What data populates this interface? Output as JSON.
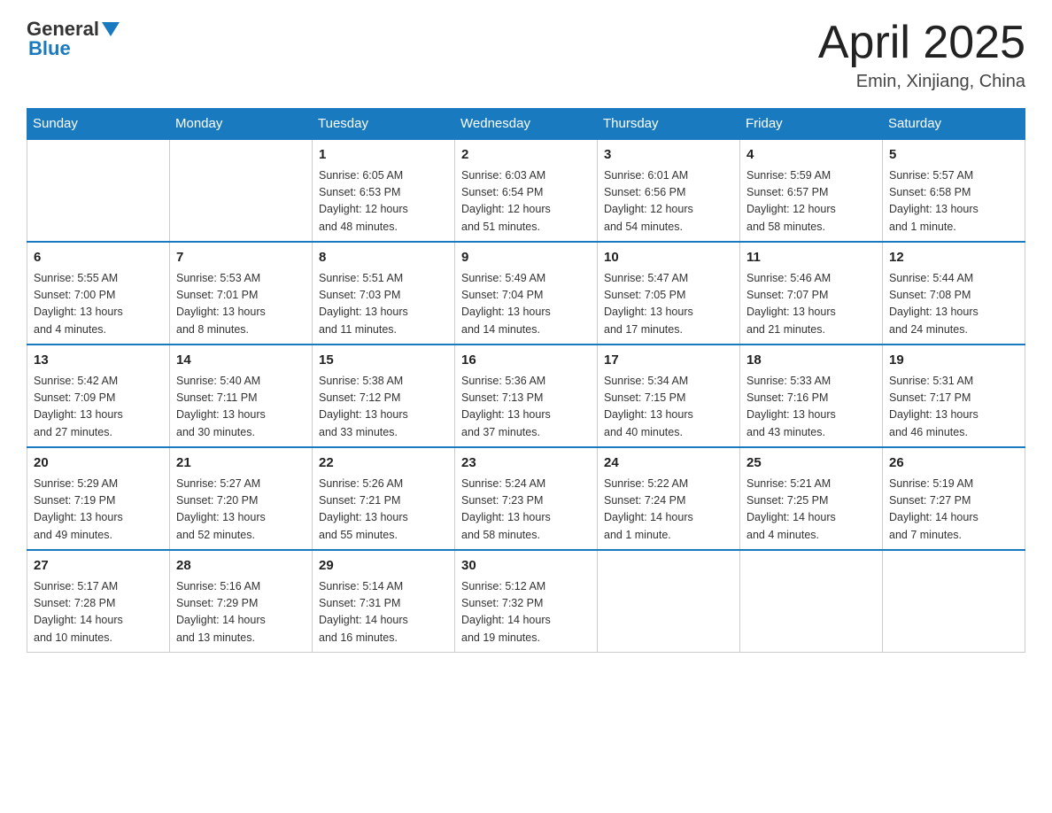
{
  "header": {
    "logo_general": "General",
    "logo_blue": "Blue",
    "title": "April 2025",
    "subtitle": "Emin, Xinjiang, China"
  },
  "days_of_week": [
    "Sunday",
    "Monday",
    "Tuesday",
    "Wednesday",
    "Thursday",
    "Friday",
    "Saturday"
  ],
  "weeks": [
    [
      {
        "day": "",
        "info": ""
      },
      {
        "day": "",
        "info": ""
      },
      {
        "day": "1",
        "info": "Sunrise: 6:05 AM\nSunset: 6:53 PM\nDaylight: 12 hours\nand 48 minutes."
      },
      {
        "day": "2",
        "info": "Sunrise: 6:03 AM\nSunset: 6:54 PM\nDaylight: 12 hours\nand 51 minutes."
      },
      {
        "day": "3",
        "info": "Sunrise: 6:01 AM\nSunset: 6:56 PM\nDaylight: 12 hours\nand 54 minutes."
      },
      {
        "day": "4",
        "info": "Sunrise: 5:59 AM\nSunset: 6:57 PM\nDaylight: 12 hours\nand 58 minutes."
      },
      {
        "day": "5",
        "info": "Sunrise: 5:57 AM\nSunset: 6:58 PM\nDaylight: 13 hours\nand 1 minute."
      }
    ],
    [
      {
        "day": "6",
        "info": "Sunrise: 5:55 AM\nSunset: 7:00 PM\nDaylight: 13 hours\nand 4 minutes."
      },
      {
        "day": "7",
        "info": "Sunrise: 5:53 AM\nSunset: 7:01 PM\nDaylight: 13 hours\nand 8 minutes."
      },
      {
        "day": "8",
        "info": "Sunrise: 5:51 AM\nSunset: 7:03 PM\nDaylight: 13 hours\nand 11 minutes."
      },
      {
        "day": "9",
        "info": "Sunrise: 5:49 AM\nSunset: 7:04 PM\nDaylight: 13 hours\nand 14 minutes."
      },
      {
        "day": "10",
        "info": "Sunrise: 5:47 AM\nSunset: 7:05 PM\nDaylight: 13 hours\nand 17 minutes."
      },
      {
        "day": "11",
        "info": "Sunrise: 5:46 AM\nSunset: 7:07 PM\nDaylight: 13 hours\nand 21 minutes."
      },
      {
        "day": "12",
        "info": "Sunrise: 5:44 AM\nSunset: 7:08 PM\nDaylight: 13 hours\nand 24 minutes."
      }
    ],
    [
      {
        "day": "13",
        "info": "Sunrise: 5:42 AM\nSunset: 7:09 PM\nDaylight: 13 hours\nand 27 minutes."
      },
      {
        "day": "14",
        "info": "Sunrise: 5:40 AM\nSunset: 7:11 PM\nDaylight: 13 hours\nand 30 minutes."
      },
      {
        "day": "15",
        "info": "Sunrise: 5:38 AM\nSunset: 7:12 PM\nDaylight: 13 hours\nand 33 minutes."
      },
      {
        "day": "16",
        "info": "Sunrise: 5:36 AM\nSunset: 7:13 PM\nDaylight: 13 hours\nand 37 minutes."
      },
      {
        "day": "17",
        "info": "Sunrise: 5:34 AM\nSunset: 7:15 PM\nDaylight: 13 hours\nand 40 minutes."
      },
      {
        "day": "18",
        "info": "Sunrise: 5:33 AM\nSunset: 7:16 PM\nDaylight: 13 hours\nand 43 minutes."
      },
      {
        "day": "19",
        "info": "Sunrise: 5:31 AM\nSunset: 7:17 PM\nDaylight: 13 hours\nand 46 minutes."
      }
    ],
    [
      {
        "day": "20",
        "info": "Sunrise: 5:29 AM\nSunset: 7:19 PM\nDaylight: 13 hours\nand 49 minutes."
      },
      {
        "day": "21",
        "info": "Sunrise: 5:27 AM\nSunset: 7:20 PM\nDaylight: 13 hours\nand 52 minutes."
      },
      {
        "day": "22",
        "info": "Sunrise: 5:26 AM\nSunset: 7:21 PM\nDaylight: 13 hours\nand 55 minutes."
      },
      {
        "day": "23",
        "info": "Sunrise: 5:24 AM\nSunset: 7:23 PM\nDaylight: 13 hours\nand 58 minutes."
      },
      {
        "day": "24",
        "info": "Sunrise: 5:22 AM\nSunset: 7:24 PM\nDaylight: 14 hours\nand 1 minute."
      },
      {
        "day": "25",
        "info": "Sunrise: 5:21 AM\nSunset: 7:25 PM\nDaylight: 14 hours\nand 4 minutes."
      },
      {
        "day": "26",
        "info": "Sunrise: 5:19 AM\nSunset: 7:27 PM\nDaylight: 14 hours\nand 7 minutes."
      }
    ],
    [
      {
        "day": "27",
        "info": "Sunrise: 5:17 AM\nSunset: 7:28 PM\nDaylight: 14 hours\nand 10 minutes."
      },
      {
        "day": "28",
        "info": "Sunrise: 5:16 AM\nSunset: 7:29 PM\nDaylight: 14 hours\nand 13 minutes."
      },
      {
        "day": "29",
        "info": "Sunrise: 5:14 AM\nSunset: 7:31 PM\nDaylight: 14 hours\nand 16 minutes."
      },
      {
        "day": "30",
        "info": "Sunrise: 5:12 AM\nSunset: 7:32 PM\nDaylight: 14 hours\nand 19 minutes."
      },
      {
        "day": "",
        "info": ""
      },
      {
        "day": "",
        "info": ""
      },
      {
        "day": "",
        "info": ""
      }
    ]
  ]
}
